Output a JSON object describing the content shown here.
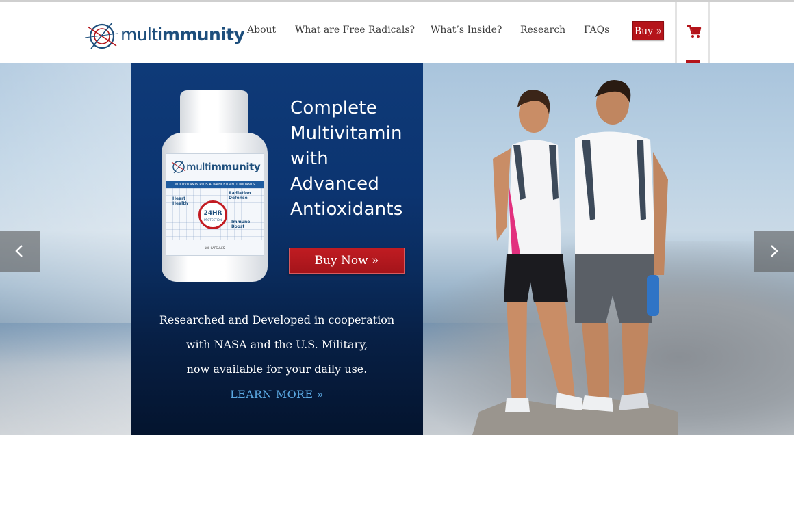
{
  "header": {
    "logo": {
      "brand_light": "multi",
      "brand_bold": "mmunity"
    },
    "nav": [
      {
        "label": "About"
      },
      {
        "label": "What are Free Radicals?"
      },
      {
        "label": "What’s Inside?"
      },
      {
        "label": "Research"
      },
      {
        "label": "FAQs"
      }
    ],
    "buy_label": "Buy »",
    "cart_icon": "shopping-cart-icon"
  },
  "hero": {
    "product": {
      "brand_light": "multi",
      "brand_bold": "mmunity",
      "strip": "MULTIVITAMIN PLUS ADVANCED ANTIOXIDANTS",
      "badge_main": "24HR",
      "badge_sub": "PROTECTION",
      "benefit_heart": "Heart Health",
      "benefit_radiation": "Radiation Defense",
      "benefit_immune": "Immune Boost",
      "capsules": "180 CAPSULES"
    },
    "headline": [
      "Complete",
      "Multivitamin",
      "with",
      "Advanced",
      "Antioxidants"
    ],
    "buy_now": "Buy Now »",
    "description": [
      "Researched and Developed in cooperation",
      "with NASA and the U.S. Military,",
      "now available for your daily use."
    ],
    "learn_more": "LEARN MORE »",
    "prev_icon": "chevron-left-icon",
    "next_icon": "chevron-right-icon"
  },
  "colors": {
    "brand_blue": "#1d4e7c",
    "accent_red": "#b4141a",
    "promo_navy": "#0c3470",
    "link_blue": "#5aa7e0"
  }
}
